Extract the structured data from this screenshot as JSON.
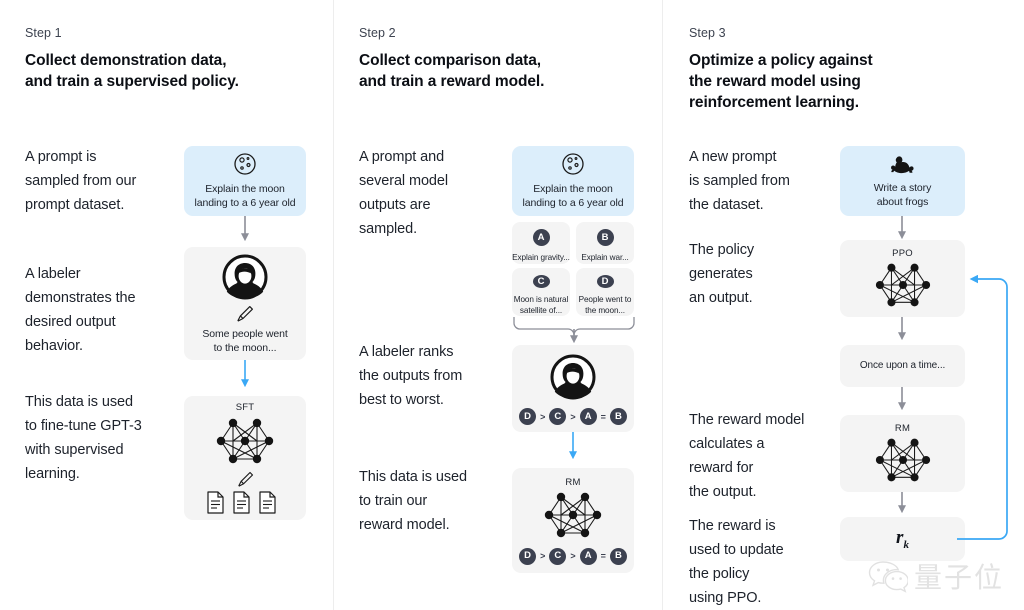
{
  "figure": {
    "title": "InstructGPT three-step training diagram",
    "background": "#ffffff",
    "divider_color": "#ededed",
    "prompt_card_color": "#dceefb",
    "neutral_card_color": "#f4f4f4",
    "badge_color": "#3c4150",
    "gray_arrow_color": "#8c8e98",
    "blue_arrow_color": "#3aa8f5"
  },
  "columns": [
    {
      "step_label": "Step 1",
      "step_title": "Collect demonstration data,\nand train a supervised policy.",
      "paragraphs": [
        "A prompt is\nsampled from our\nprompt dataset.",
        "A labeler\ndemonstrates the\ndesired output\nbehavior.",
        "This data is used\nto fine-tune GPT-3\nwith supervised\nlearning."
      ],
      "cards": [
        {
          "name": "prompt-card",
          "kind": "prompt",
          "icon": "moon-icon",
          "text": "Explain the moon\nlanding to a 6 year old"
        },
        {
          "name": "labeler-demo-card",
          "kind": "neutral",
          "icon": "labeler-icon",
          "text": "Some people went\nto the moon..."
        },
        {
          "name": "sft-model-card",
          "kind": "neutral",
          "icon": "neural-net-icon",
          "label": "SFT",
          "text": ""
        }
      ],
      "sft_label": "SFT"
    },
    {
      "step_label": "Step 2",
      "step_title": "Collect comparison data,\nand train a reward model.",
      "paragraphs": [
        "A prompt and\nseveral model\noutputs are\nsampled.",
        "A labeler ranks\nthe outputs from\nbest to worst.",
        "This data is used\nto train our\nreward model."
      ],
      "cards": [
        {
          "name": "prompt-card",
          "kind": "prompt",
          "icon": "moon-icon",
          "text": "Explain the moon\nlanding to a 6 year old"
        },
        {
          "name": "labeler-rank-card",
          "kind": "neutral",
          "icon": "labeler-icon",
          "text": ""
        },
        {
          "name": "reward-model-card",
          "kind": "neutral",
          "icon": "neural-net-icon",
          "label": "RM",
          "text": ""
        }
      ],
      "outputs": [
        {
          "badge": "A",
          "text": "Explain gravity..."
        },
        {
          "badge": "B",
          "text": "Explain war..."
        },
        {
          "badge": "C",
          "text": "Moon is natural\nsatellite of..."
        },
        {
          "badge": "D",
          "text": "People went to\nthe moon..."
        }
      ],
      "ranking": [
        {
          "badge": "D",
          "op": ">"
        },
        {
          "badge": "C",
          "op": ">"
        },
        {
          "badge": "A",
          "op": "="
        },
        {
          "badge": "B",
          "op": ""
        }
      ],
      "rm_label": "RM"
    },
    {
      "step_label": "Step 3",
      "step_title": "Optimize a policy against\nthe reward model using\nreinforcement learning.",
      "paragraphs": [
        "A new prompt\nis sampled from\nthe dataset.",
        "The policy\ngenerates\nan output.",
        "The reward model\ncalculates a\nreward for\nthe output.",
        "The reward is\nused to update\nthe policy\nusing PPO."
      ],
      "cards": [
        {
          "name": "new-prompt-card",
          "kind": "prompt",
          "icon": "frog-icon",
          "text": "Write a story\nabout frogs"
        },
        {
          "name": "ppo-policy-card",
          "kind": "neutral",
          "icon": "neural-net-icon",
          "label": "PPO",
          "text": ""
        },
        {
          "name": "generated-output-card",
          "kind": "neutral",
          "icon": "",
          "text": "Once upon a time..."
        },
        {
          "name": "reward-model-card",
          "kind": "neutral",
          "icon": "neural-net-icon",
          "label": "RM",
          "text": ""
        },
        {
          "name": "reward-value-card",
          "kind": "neutral",
          "icon": "",
          "text": "",
          "math": "r",
          "math_sub": "k"
        }
      ],
      "ppo_label": "PPO",
      "rm_label": "RM",
      "output_text": "Once upon a time...",
      "reward_symbol": "r",
      "reward_subscript": "k"
    }
  ],
  "watermark": {
    "icon": "wechat-icon",
    "text": "量子位"
  }
}
